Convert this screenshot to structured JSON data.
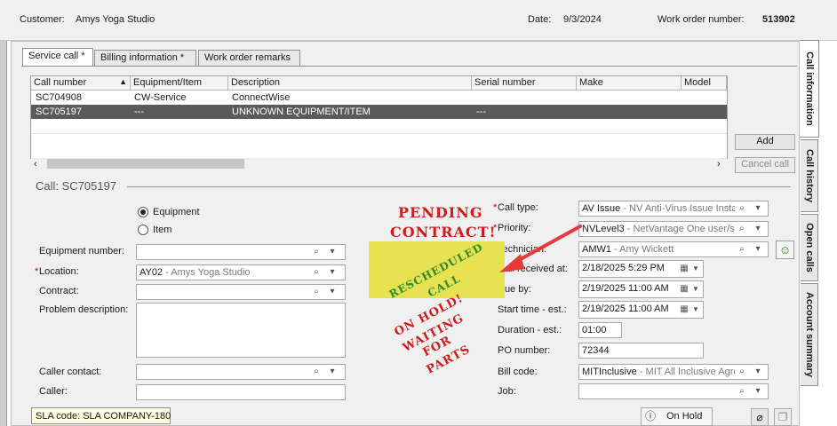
{
  "header": {
    "customer_label": "Customer:",
    "customer_value": "Amys Yoga Studio",
    "date_label": "Date:",
    "date_value": "9/3/2024",
    "wo_label": "Work order number:",
    "wo_value": "513902"
  },
  "tabs": [
    "Service call *",
    "Billing information *",
    "Work order remarks"
  ],
  "side_tabs": [
    "Call information",
    "Call history",
    "Open calls",
    "Account summary"
  ],
  "grid": {
    "columns": [
      "Call number",
      "Equipment/Item",
      "Description",
      "Serial number",
      "Make",
      "Model"
    ],
    "rows": [
      {
        "call": "SC704908",
        "equip": "CW-Service",
        "desc": "ConnectWise",
        "serial": ""
      },
      {
        "call": "SC705197",
        "equip": "---",
        "desc": "UNKNOWN EQUIPMENT/ITEM",
        "serial": "---"
      }
    ]
  },
  "buttons": {
    "add": "Add",
    "cancel_call": "Cancel call",
    "on_hold": "On Hold"
  },
  "call_title": "Call: SC705197",
  "radio": {
    "equipment": "Equipment",
    "item": "Item"
  },
  "left_form": {
    "equipment_number_label": "Equipment number:",
    "location_label": "Location:",
    "location_code": "AY02",
    "location_name": " - Amys Yoga Studio",
    "contract_label": "Contract:",
    "problem_label": "Problem description:",
    "caller_contact_label": "Caller contact:",
    "caller_label": "Caller:"
  },
  "right_form": {
    "call_type_label": "Call type:",
    "call_type_code": "AV Issue",
    "call_type_desc": " - NV Anti-Virus Issue Instal",
    "priority_label": "Priority:",
    "priority_code": "NVLevel3",
    "priority_desc": " - NetVantage One user/sm",
    "technician_label": "Technician:",
    "technician_code": "AMW1",
    "technician_desc": " - Amy Wickett",
    "call_received_label": "Call received at:",
    "call_received_value": "2/18/2025  5:29 PM",
    "due_by_label": "Due by:",
    "due_by_value": "2/19/2025 11:00 AM",
    "start_time_label": "Start time - est.:",
    "start_time_value": "2/19/2025 11:00 AM",
    "duration_label": "Duration - est.:",
    "duration_value": "01:00",
    "po_label": "PO number:",
    "po_value": "72344",
    "bill_code_label": "Bill code:",
    "bill_code_code": "MITInclusive",
    "bill_code_desc": " - MIT All Inclusive Agre",
    "job_label": "Job:"
  },
  "required_mark": "*",
  "sla": "SLA code: SLA COMPANY-180",
  "stamps": {
    "pending1": "PENDING",
    "pending2": "CONTRACT!",
    "resched1": "RESCHEDULED",
    "resched2": "CALL",
    "hold1": "ON HOLD!",
    "hold2": "WAITING",
    "hold3": "FOR",
    "hold4": "PARTS"
  },
  "colors": {
    "selected_row": "#5a5a5a",
    "sticker": "#e6e251",
    "stamp_red": "#d21b1b",
    "arrow": "#e8383a"
  },
  "icons": [
    "magnifier-icon",
    "lookup-menu-icon",
    "calendar-icon",
    "sort-asc-icon",
    "scroll-left-icon",
    "scroll-right-icon",
    "person-icon",
    "paperclip-icon",
    "copy-icon",
    "on-hold-icon"
  ]
}
